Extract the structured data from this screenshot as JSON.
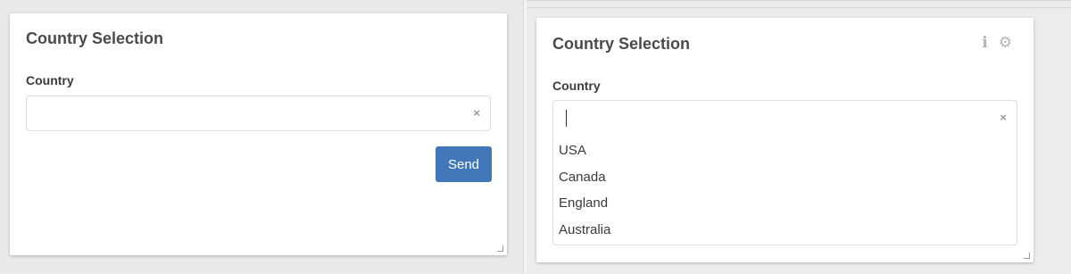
{
  "left_widget": {
    "title": "Country Selection",
    "country_label": "Country",
    "country_value": "",
    "clear_glyph": "×",
    "send_label": "Send"
  },
  "right_widget": {
    "title": "Country Selection",
    "country_label": "Country",
    "country_value": "",
    "clear_glyph": "×",
    "header_icons": [
      "info-icon",
      "gear-icon"
    ],
    "dropdown_options": [
      "USA",
      "Canada",
      "England",
      "Australia"
    ]
  },
  "colors": {
    "send_button": "#4278ba",
    "icon_gray": "#b4b4b4"
  }
}
